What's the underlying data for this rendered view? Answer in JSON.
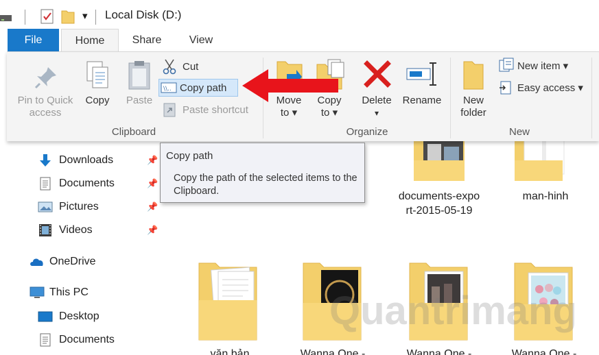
{
  "titlebar": {
    "title": "Local Disk (D:)",
    "dropdown_glyph": "▾"
  },
  "tabs": [
    {
      "label": "File"
    },
    {
      "label": "Home"
    },
    {
      "label": "Share"
    },
    {
      "label": "View"
    }
  ],
  "ribbon": {
    "clipboard": {
      "group_label": "Clipboard",
      "pin_label_1": "Pin to Quick",
      "pin_label_2": "access",
      "copy_label": "Copy",
      "paste_label": "Paste",
      "cut_label": "Cut",
      "copy_path_label": "Copy path",
      "paste_shortcut_label": "Paste shortcut"
    },
    "organize": {
      "group_label": "Organize",
      "move_to_1": "Move",
      "move_to_2": "to ▾",
      "copy_to_1": "Copy",
      "copy_to_2": "to ▾",
      "delete_label": "Delete",
      "delete_arrow": "▾",
      "rename_label": "Rename"
    },
    "new": {
      "group_label": "New",
      "new_folder_1": "New",
      "new_folder_2": "folder",
      "new_item_label": "New item ▾",
      "easy_access_label": "Easy access ▾"
    }
  },
  "tooltip": {
    "title": "Copy path",
    "description": "Copy the path of the selected items to the Clipboard."
  },
  "nav": {
    "quick_access": [
      {
        "label": "Downloads",
        "icon": "download-arrow-icon"
      },
      {
        "label": "Documents",
        "icon": "documents-icon"
      },
      {
        "label": "Pictures",
        "icon": "pictures-icon"
      },
      {
        "label": "Videos",
        "icon": "videos-icon"
      }
    ],
    "onedrive": "OneDrive",
    "this_pc": "This PC",
    "this_pc_items": [
      {
        "label": "Desktop",
        "icon": "desktop-icon"
      },
      {
        "label": "Documents",
        "icon": "documents-icon"
      }
    ]
  },
  "files": {
    "row1": [
      {
        "name_1": "documents-expo",
        "name_2": "rt-2015-05-19"
      },
      {
        "name_1": "man-hinh",
        "name_2": ""
      }
    ],
    "row2": [
      {
        "name": "văn bản"
      },
      {
        "name": "Wanna One -"
      },
      {
        "name": "Wanna One -"
      },
      {
        "name": "Wanna One -"
      }
    ]
  },
  "watermark": "Quantrimang",
  "colors": {
    "accent": "#1979ca",
    "arrow_red": "#e8141b",
    "folder_yellow": "#f3cf6b",
    "delete_red": "#d9201e"
  }
}
